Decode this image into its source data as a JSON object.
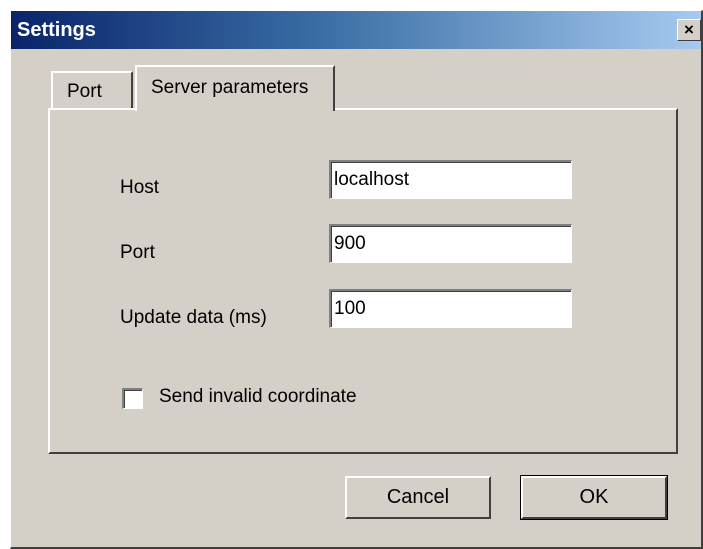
{
  "window": {
    "title": "Settings",
    "close_glyph": "×"
  },
  "tabs": [
    {
      "label": "Port",
      "selected": false
    },
    {
      "label": "Server parameters",
      "selected": true
    }
  ],
  "form": {
    "host_label": "Host",
    "host_value": "localhost",
    "port_label": "Port",
    "port_value": "900",
    "update_label": "Update data (ms)",
    "update_value": "100",
    "send_invalid_label": "Send invalid coordinate",
    "send_invalid_checked": false
  },
  "buttons": {
    "cancel": "Cancel",
    "ok": "OK"
  },
  "colors": {
    "face": "#d4d0c8",
    "title_start": "#0a246a",
    "title_end": "#a6caf0"
  }
}
